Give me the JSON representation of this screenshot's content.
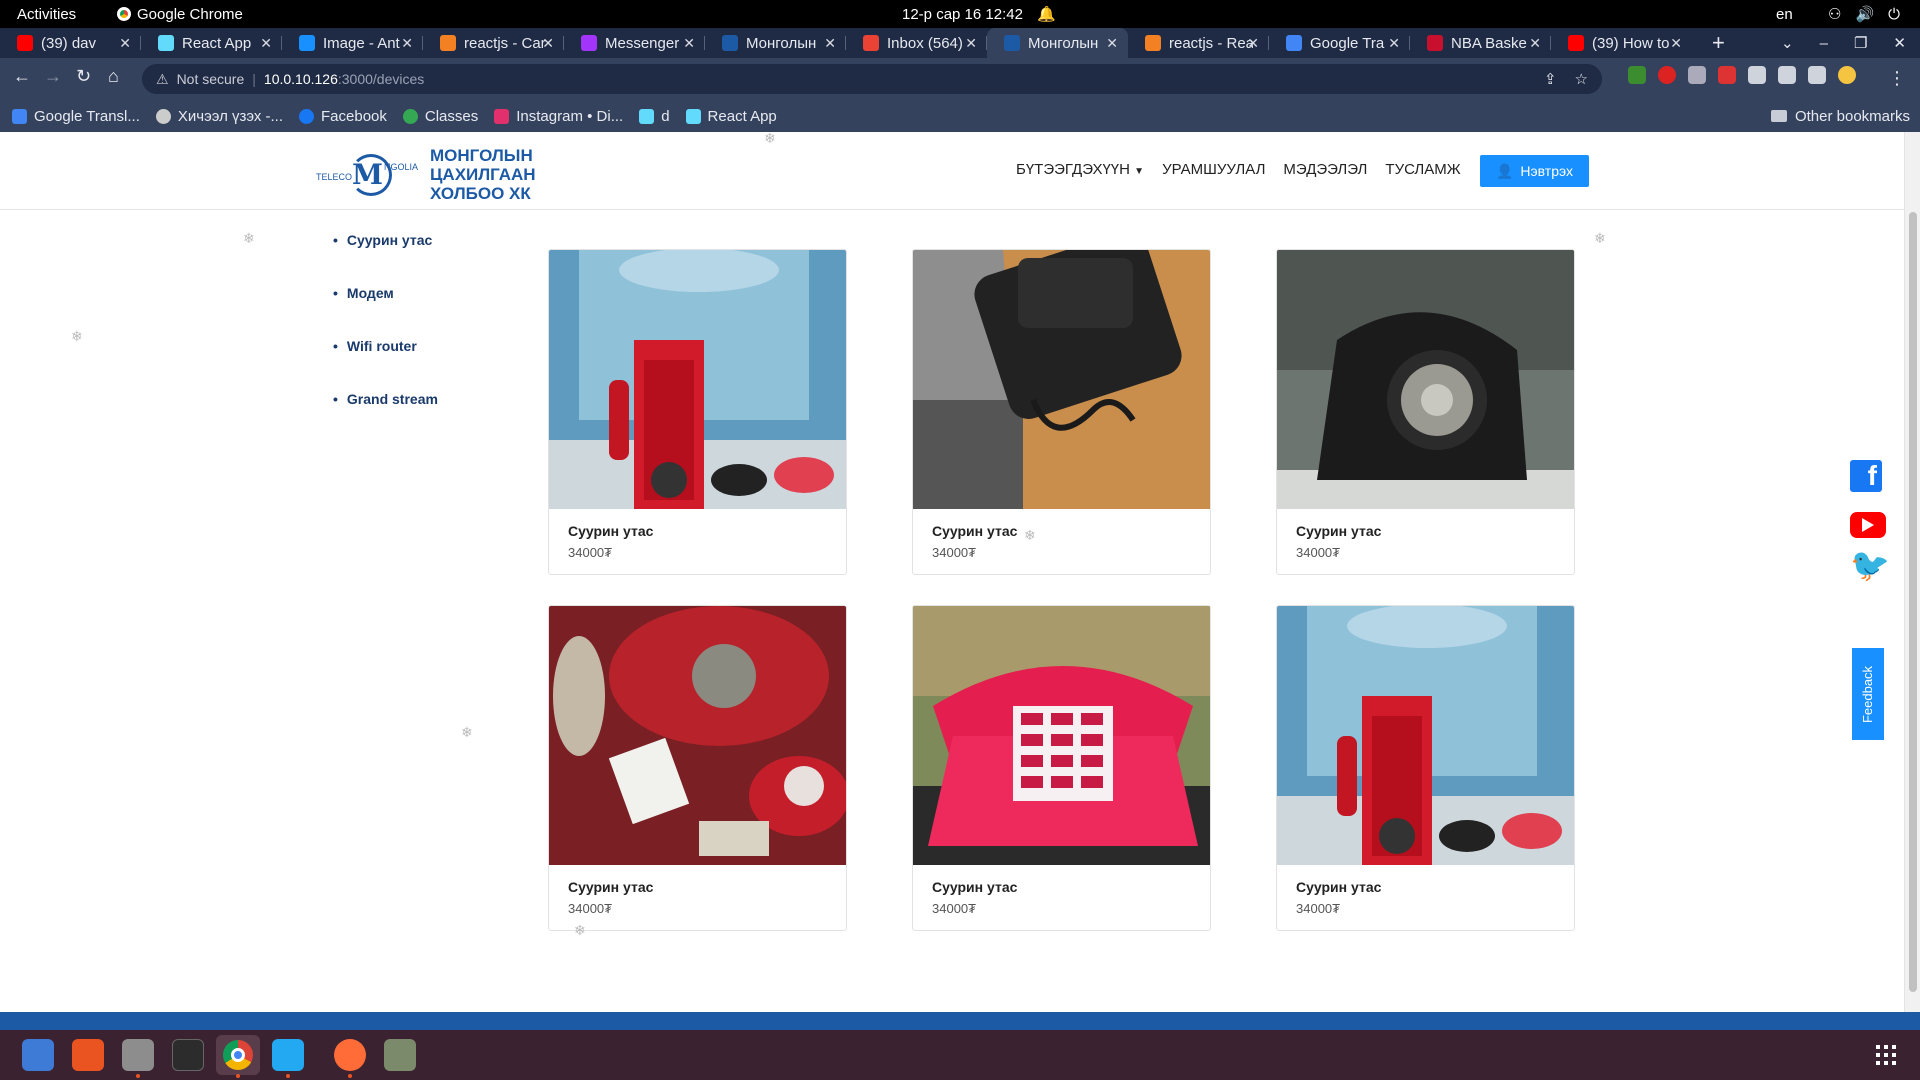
{
  "topbar": {
    "activities": "Activities",
    "app_name": "Google Chrome",
    "clock": "12-р сар 16  12:42",
    "lang": "en"
  },
  "tabs": [
    {
      "label": "(39) dav",
      "favicon_color": "#ff0000",
      "favicon": "youtube-icon"
    },
    {
      "label": "React App",
      "favicon_color": "#61dafb",
      "favicon": "react-icon"
    },
    {
      "label": "Image - Ant",
      "favicon_color": "#1890ff",
      "favicon": "ant-design-icon"
    },
    {
      "label": "reactjs - Car",
      "favicon_color": "#f48024",
      "favicon": "stackoverflow-icon"
    },
    {
      "label": "Messenger",
      "favicon_color": "#a334fa",
      "favicon": "messenger-icon"
    },
    {
      "label": "Монголын",
      "favicon_color": "#1d5aa6",
      "favicon": "site-icon"
    },
    {
      "label": "Inbox (564)",
      "favicon_color": "#ea4335",
      "favicon": "gmail-icon"
    },
    {
      "label": "Монголын",
      "favicon_color": "#1d5aa6",
      "favicon": "site-icon"
    },
    {
      "label": "reactjs - Rea",
      "favicon_color": "#f48024",
      "favicon": "stackoverflow-icon"
    },
    {
      "label": "Google Tra",
      "favicon_color": "#4285f4",
      "favicon": "translate-icon"
    },
    {
      "label": "NBA Baske",
      "favicon_color": "#c8102e",
      "favicon": "nba-icon"
    },
    {
      "label": "(39) How to",
      "favicon_color": "#ff0000",
      "favicon": "youtube-icon"
    }
  ],
  "address": {
    "security": "Not secure",
    "host": "10.0.10.126",
    "path": ":3000/devices"
  },
  "bookmarks": [
    {
      "label": "Google Transl...",
      "color": "#4285f4"
    },
    {
      "label": "Хичээл үзэх -...",
      "color": "#cccccc"
    },
    {
      "label": "Facebook",
      "color": "#1877f2"
    },
    {
      "label": "Classes",
      "color": "#34a853"
    },
    {
      "label": "Instagram • Di...",
      "color": "#e1306c"
    },
    {
      "label": "d",
      "color": "#61dafb"
    },
    {
      "label": "React App",
      "color": "#61dafb"
    }
  ],
  "bookmarks_other": "Other bookmarks",
  "site": {
    "logo_lines": [
      "МОНГОЛЫН",
      "ЦАХИЛГААН",
      "ХОЛБОО ХК"
    ],
    "logo_mark": {
      "tele": "TELECO",
      "m": "M",
      "ngol": "NGOLIA"
    },
    "nav": [
      "БҮТЭЭГДЭХҮҮН",
      "УРАМШУУЛАЛ",
      "МЭДЭЭЛЭЛ",
      "ТУСЛАМЖ"
    ],
    "login": "Нэвтрэх",
    "categories": [
      "Суурин утас",
      "Модем",
      "Wifi router",
      "Grand stream"
    ],
    "products": [
      {
        "name": "Суурин утас",
        "price": "34000₮"
      },
      {
        "name": "Суурин утас",
        "price": "34000₮"
      },
      {
        "name": "Суурин утас",
        "price": "34000₮"
      },
      {
        "name": "Суурин утас",
        "price": "34000₮"
      },
      {
        "name": "Суурин утас",
        "price": "34000₮"
      },
      {
        "name": "Суурин утас",
        "price": "34000₮"
      }
    ],
    "feedback": "Feedback",
    "facebook_letter": "f"
  }
}
